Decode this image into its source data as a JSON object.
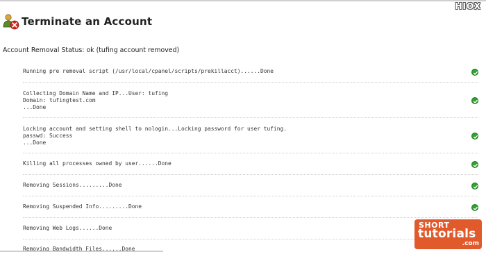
{
  "watermark": "HIOX",
  "page": {
    "title": "Terminate an Account"
  },
  "status_line": "Account Removal Status: ok (tufing account removed)",
  "steps": [
    {
      "text": "Running pre removal script (/usr/local/cpanel/scripts/prekillacct)......Done"
    },
    {
      "text": "Collecting Domain Name and IP...User: tufing\nDomain: tufingtest.com\n...Done"
    },
    {
      "text": "Locking account and setting shell to nologin...Locking password for user tufing.\npasswd: Success\n...Done"
    },
    {
      "text": "Killing all processes owned by user......Done"
    },
    {
      "text": "Removing Sessions.........Done"
    },
    {
      "text": "Removing Suspended Info.........Done"
    },
    {
      "text": "Removing Web Logs......Done"
    },
    {
      "text": "Removing Bandwidth Files......Done"
    }
  ],
  "status_icon": "check-circle-icon",
  "colors": {
    "check": "#2fa22f",
    "logo_bg": "#e05a2b"
  },
  "logo": {
    "line1": "SHORT",
    "line2": "tutorials",
    "line3": ".com"
  }
}
